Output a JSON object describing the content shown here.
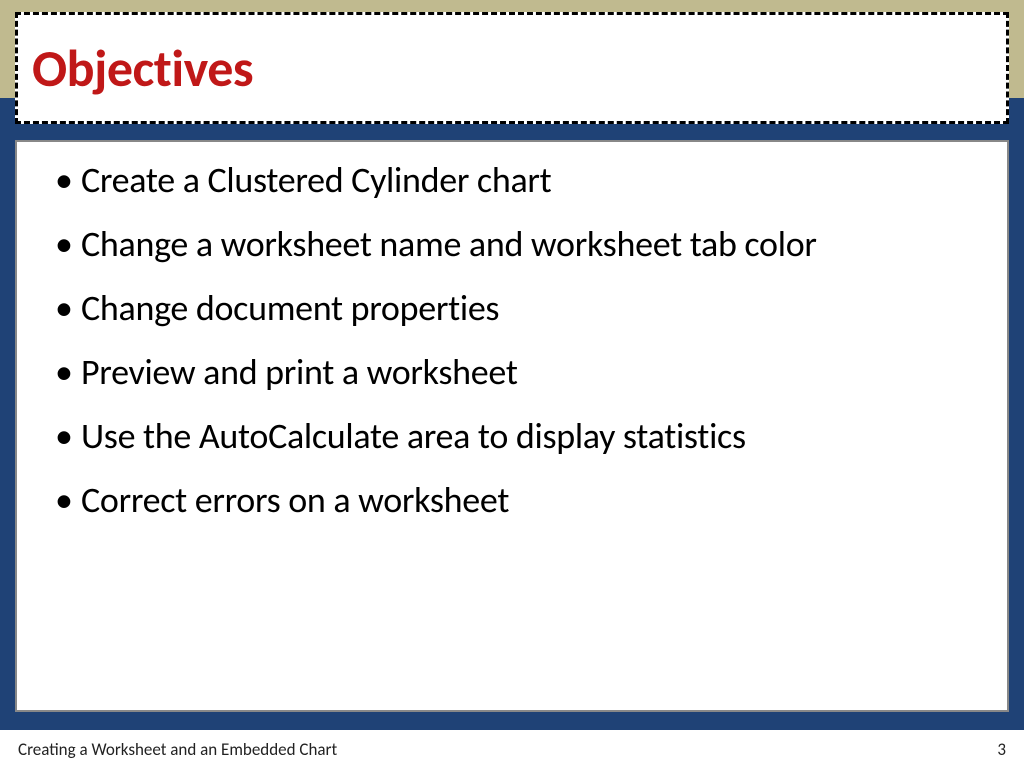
{
  "title": "Objectives",
  "bullets": [
    "Create a Clustered Cylinder chart",
    "Change a worksheet name and worksheet tab color",
    "Change document properties",
    "Preview and print a worksheet",
    "Use the AutoCalculate area to display statistics",
    "Correct errors on a worksheet"
  ],
  "footer": {
    "text": "Creating a Worksheet and an Embedded Chart",
    "page": "3"
  }
}
